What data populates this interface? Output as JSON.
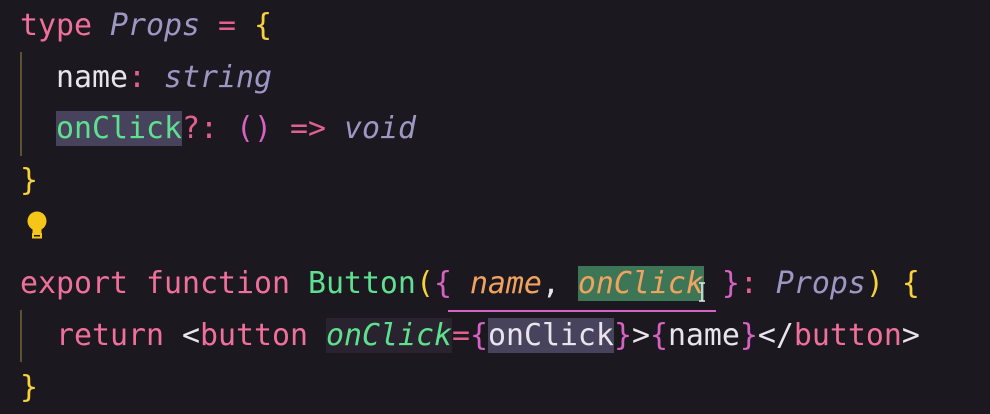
{
  "colors": {
    "background": "#1c1820",
    "keyword": "#f0709a",
    "function": "#5ee08f",
    "brace": "#f7d23c",
    "jsx_brace": "#d463c4",
    "type": "#9d97c4",
    "param": "#f0a35e"
  },
  "lines": [
    {
      "tokens": [
        {
          "t": "type",
          "c": "kw"
        },
        {
          "t": " ",
          "c": ""
        },
        {
          "t": "Props",
          "c": "type"
        },
        {
          "t": " ",
          "c": ""
        },
        {
          "t": "=",
          "c": "op"
        },
        {
          "t": " ",
          "c": ""
        },
        {
          "t": "{",
          "c": "by"
        }
      ]
    },
    {
      "tokens": [
        {
          "t": "  ",
          "c": ""
        },
        {
          "t": "name",
          "c": "prop"
        },
        {
          "t": ":",
          "c": "op"
        },
        {
          "t": " ",
          "c": ""
        },
        {
          "t": "string",
          "c": "type"
        }
      ]
    },
    {
      "tokens": [
        {
          "t": "  ",
          "c": ""
        },
        {
          "t": "onClick",
          "c": "fn hl-sel"
        },
        {
          "t": "?:",
          "c": "op"
        },
        {
          "t": " ",
          "c": ""
        },
        {
          "t": "()",
          "c": "bm"
        },
        {
          "t": " ",
          "c": ""
        },
        {
          "t": "=>",
          "c": "op"
        },
        {
          "t": " ",
          "c": ""
        },
        {
          "t": "void",
          "c": "type"
        }
      ]
    },
    {
      "tokens": [
        {
          "t": "}",
          "c": "by"
        }
      ]
    },
    {
      "tokens": []
    },
    {
      "tokens": [
        {
          "t": "export",
          "c": "kw"
        },
        {
          "t": " ",
          "c": ""
        },
        {
          "t": "function",
          "c": "kw"
        },
        {
          "t": " ",
          "c": ""
        },
        {
          "t": "Button",
          "c": "fn"
        },
        {
          "t": "(",
          "c": "by"
        },
        {
          "t": "{",
          "c": "bm"
        },
        {
          "t": " ",
          "c": ""
        },
        {
          "t": "name",
          "c": "param"
        },
        {
          "t": ",",
          "c": "prop"
        },
        {
          "t": " ",
          "c": ""
        },
        {
          "t": "onClick",
          "c": "param hl-green"
        },
        {
          "t": " ",
          "c": ""
        },
        {
          "t": "}",
          "c": "bm"
        },
        {
          "t": ":",
          "c": "op"
        },
        {
          "t": " ",
          "c": ""
        },
        {
          "t": "Props",
          "c": "type"
        },
        {
          "t": ")",
          "c": "by"
        },
        {
          "t": " ",
          "c": ""
        },
        {
          "t": "{",
          "c": "by"
        }
      ]
    },
    {
      "tokens": [
        {
          "t": "  ",
          "c": ""
        },
        {
          "t": "return",
          "c": "kw"
        },
        {
          "t": " ",
          "c": ""
        },
        {
          "t": "<",
          "c": "prop"
        },
        {
          "t": "button",
          "c": "kw"
        },
        {
          "t": " ",
          "c": ""
        },
        {
          "t": "onClick",
          "c": "attr hl-faint"
        },
        {
          "t": "=",
          "c": "op"
        },
        {
          "t": "{",
          "c": "bm"
        },
        {
          "t": "onClick",
          "c": "prop hl-sel"
        },
        {
          "t": "}",
          "c": "bm"
        },
        {
          "t": ">",
          "c": "prop"
        },
        {
          "t": "{",
          "c": "bm"
        },
        {
          "t": "name",
          "c": "prop"
        },
        {
          "t": "}",
          "c": "bm"
        },
        {
          "t": "</",
          "c": "prop"
        },
        {
          "t": "button",
          "c": "kw"
        },
        {
          "t": ">",
          "c": "prop"
        }
      ]
    },
    {
      "tokens": [
        {
          "t": "}",
          "c": "by"
        }
      ]
    }
  ]
}
